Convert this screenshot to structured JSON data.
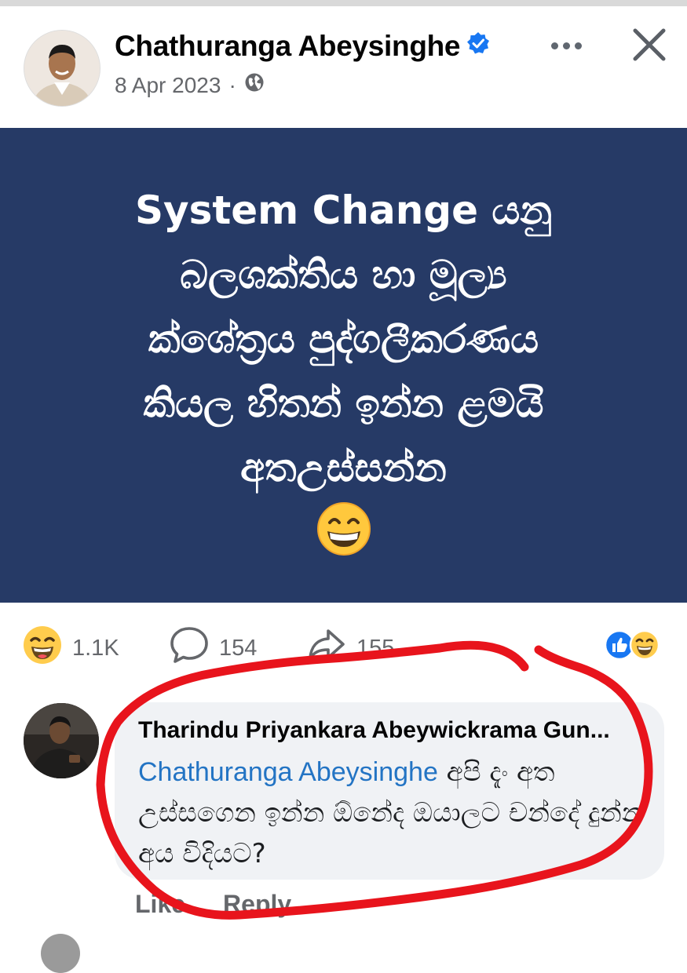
{
  "post": {
    "author": "Chathuranga Abeysinghe",
    "date": "8 Apr 2023",
    "separator": "·",
    "privacy_icon": "globe-icon",
    "verified_icon": "verified-badge-icon",
    "lines": [
      "System Change යනු",
      "බලශක්තිය හා මූල්‍ය",
      "ක්ශේත්‍රය පුද්ගලීකරණය",
      "කියල හිතන් ඉන්න ළමයි",
      "අතඋස්සන්න"
    ],
    "emoji": "grinning-face-icon",
    "background": "#263a66"
  },
  "stats": {
    "reactions": "1.1K",
    "comments": "154",
    "shares": "155"
  },
  "comment": {
    "author": "Tharindu Priyankara Abeywickrama Gun...",
    "mention": "Chathuranga Abeysinghe",
    "text": " අපි දැං අත උස්සගෙන ඉන්න ඕනේද ඔයාලට චන්දේ දුන්න අය විදියට?",
    "like": "Like",
    "reply": "Reply"
  },
  "colors": {
    "accent": "#1877f2",
    "mention": "#2374c4",
    "highlight": "#e8141c"
  }
}
